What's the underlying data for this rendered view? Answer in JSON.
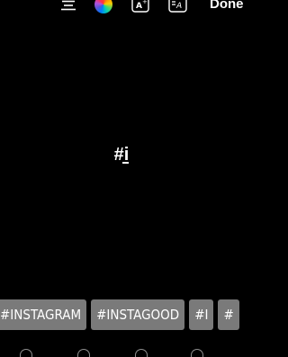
{
  "toolbar": {
    "align_icon": "align-center-icon",
    "color_icon": "color-wheel-icon",
    "text_style_icon": "text-effect-icon",
    "animate_icon": "text-animation-icon",
    "done_label": "Done"
  },
  "editor": {
    "text": "#i"
  },
  "suggestions": [
    "#INSTAGRAM",
    "#INSTAGOOD",
    "#I",
    "#"
  ],
  "colors": {
    "background": "#000000",
    "chip_background": "#7a7a7a",
    "text": "#ffffff"
  }
}
